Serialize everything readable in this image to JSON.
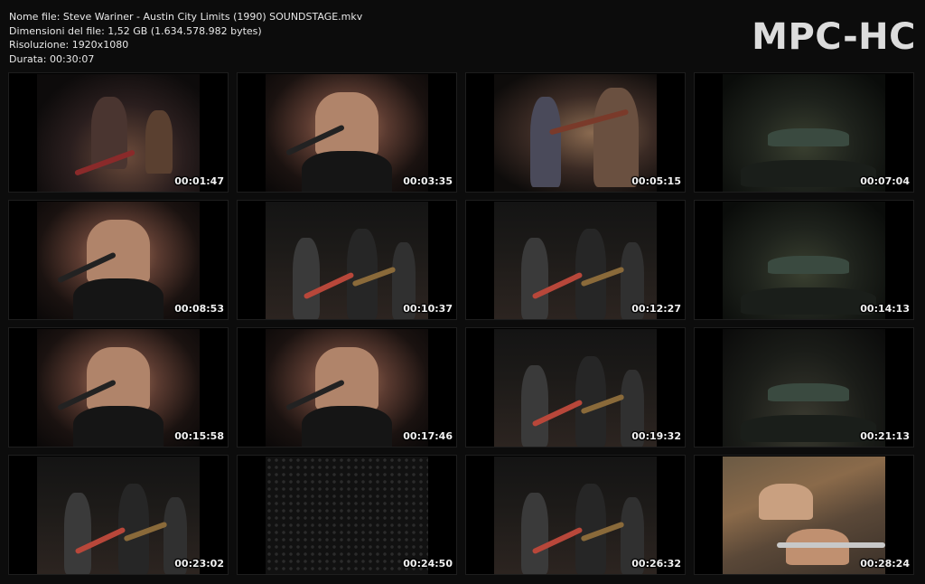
{
  "header": {
    "filename": "Nome file: Steve Wariner - Austin City Limits (1990) SOUNDSTAGE.mkv",
    "filesize": "Dimensioni del file: 1,52 GB (1.634.578.982 bytes)",
    "resolution": "Risoluzione: 1920x1080",
    "duration": "Durata: 00:30:07"
  },
  "brand": "MPC-HC",
  "thumbnails": [
    {
      "time": "00:01:47",
      "scene": "stage"
    },
    {
      "time": "00:03:35",
      "scene": "close"
    },
    {
      "time": "00:05:15",
      "scene": "fiddle"
    },
    {
      "time": "00:07:04",
      "scene": "wide"
    },
    {
      "time": "00:08:53",
      "scene": "close"
    },
    {
      "time": "00:10:37",
      "scene": "band"
    },
    {
      "time": "00:12:27",
      "scene": "band"
    },
    {
      "time": "00:14:13",
      "scene": "wide"
    },
    {
      "time": "00:15:58",
      "scene": "close"
    },
    {
      "time": "00:17:46",
      "scene": "close"
    },
    {
      "time": "00:19:32",
      "scene": "band"
    },
    {
      "time": "00:21:13",
      "scene": "crowd"
    },
    {
      "time": "00:23:02",
      "scene": "band"
    },
    {
      "time": "00:24:50",
      "scene": "dark"
    },
    {
      "time": "00:26:32",
      "scene": "band"
    },
    {
      "time": "00:28:24",
      "scene": "hand"
    }
  ]
}
